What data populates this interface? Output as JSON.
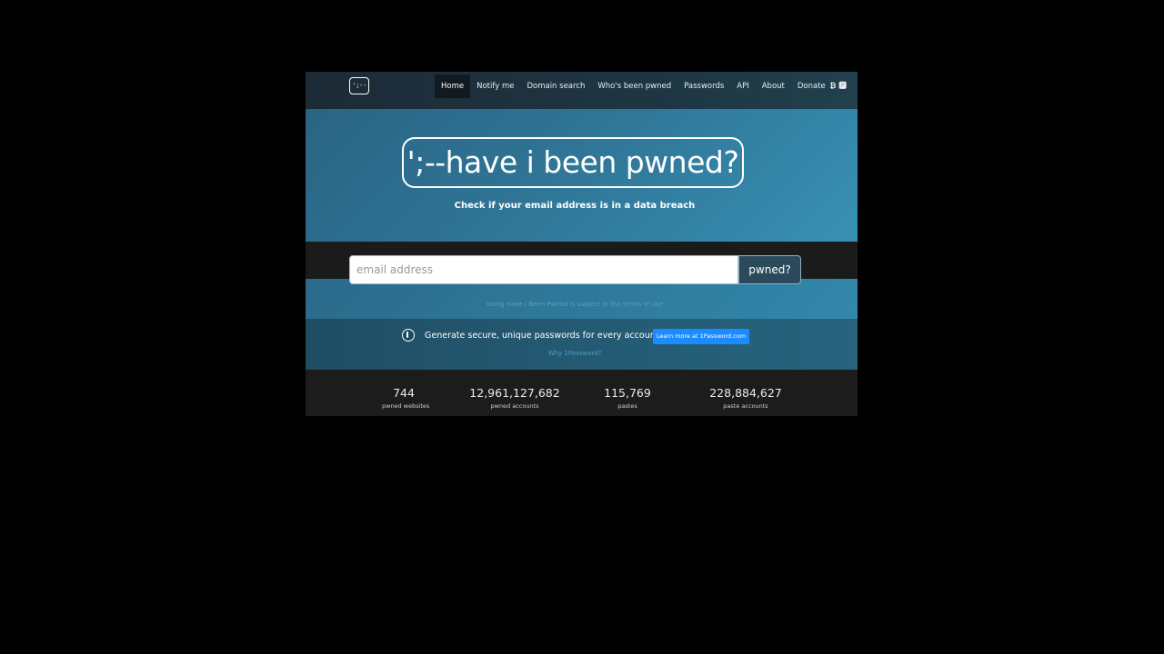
{
  "nav": {
    "logo_text": "';--",
    "items": [
      {
        "label": "Home",
        "active": true
      },
      {
        "label": "Notify me"
      },
      {
        "label": "Domain search"
      },
      {
        "label": "Who's been pwned"
      },
      {
        "label": "Passwords"
      },
      {
        "label": "API"
      },
      {
        "label": "About"
      },
      {
        "label": "Donate"
      }
    ],
    "donate_icons": "₿ 🅿"
  },
  "hero": {
    "title": "';--have i been pwned?",
    "tagline": "Check if your email address is in a data breach"
  },
  "search": {
    "placeholder": "email address",
    "value": "",
    "button_label": "pwned?",
    "terms_text": "Using Have I Been Pwned is subject to the terms of use"
  },
  "promo": {
    "icon": "1password-icon",
    "text": "Generate secure, unique passwords for every account",
    "button_label": "Learn more at 1Password.com",
    "why_link": "Why 1Password?"
  },
  "stats": [
    {
      "value": "744",
      "label": "pwned websites"
    },
    {
      "value": "12,961,127,682",
      "label": "pwned accounts"
    },
    {
      "value": "115,769",
      "label": "pastes"
    },
    {
      "value": "228,884,627",
      "label": "paste accounts"
    }
  ],
  "colors": {
    "page_background": "#000000",
    "navbar": "#1e3542",
    "hero": "#2f7596",
    "promo_button": "#1a8cff",
    "search_button": "#2b4b5c",
    "stats_background": "#1c1c1c"
  }
}
